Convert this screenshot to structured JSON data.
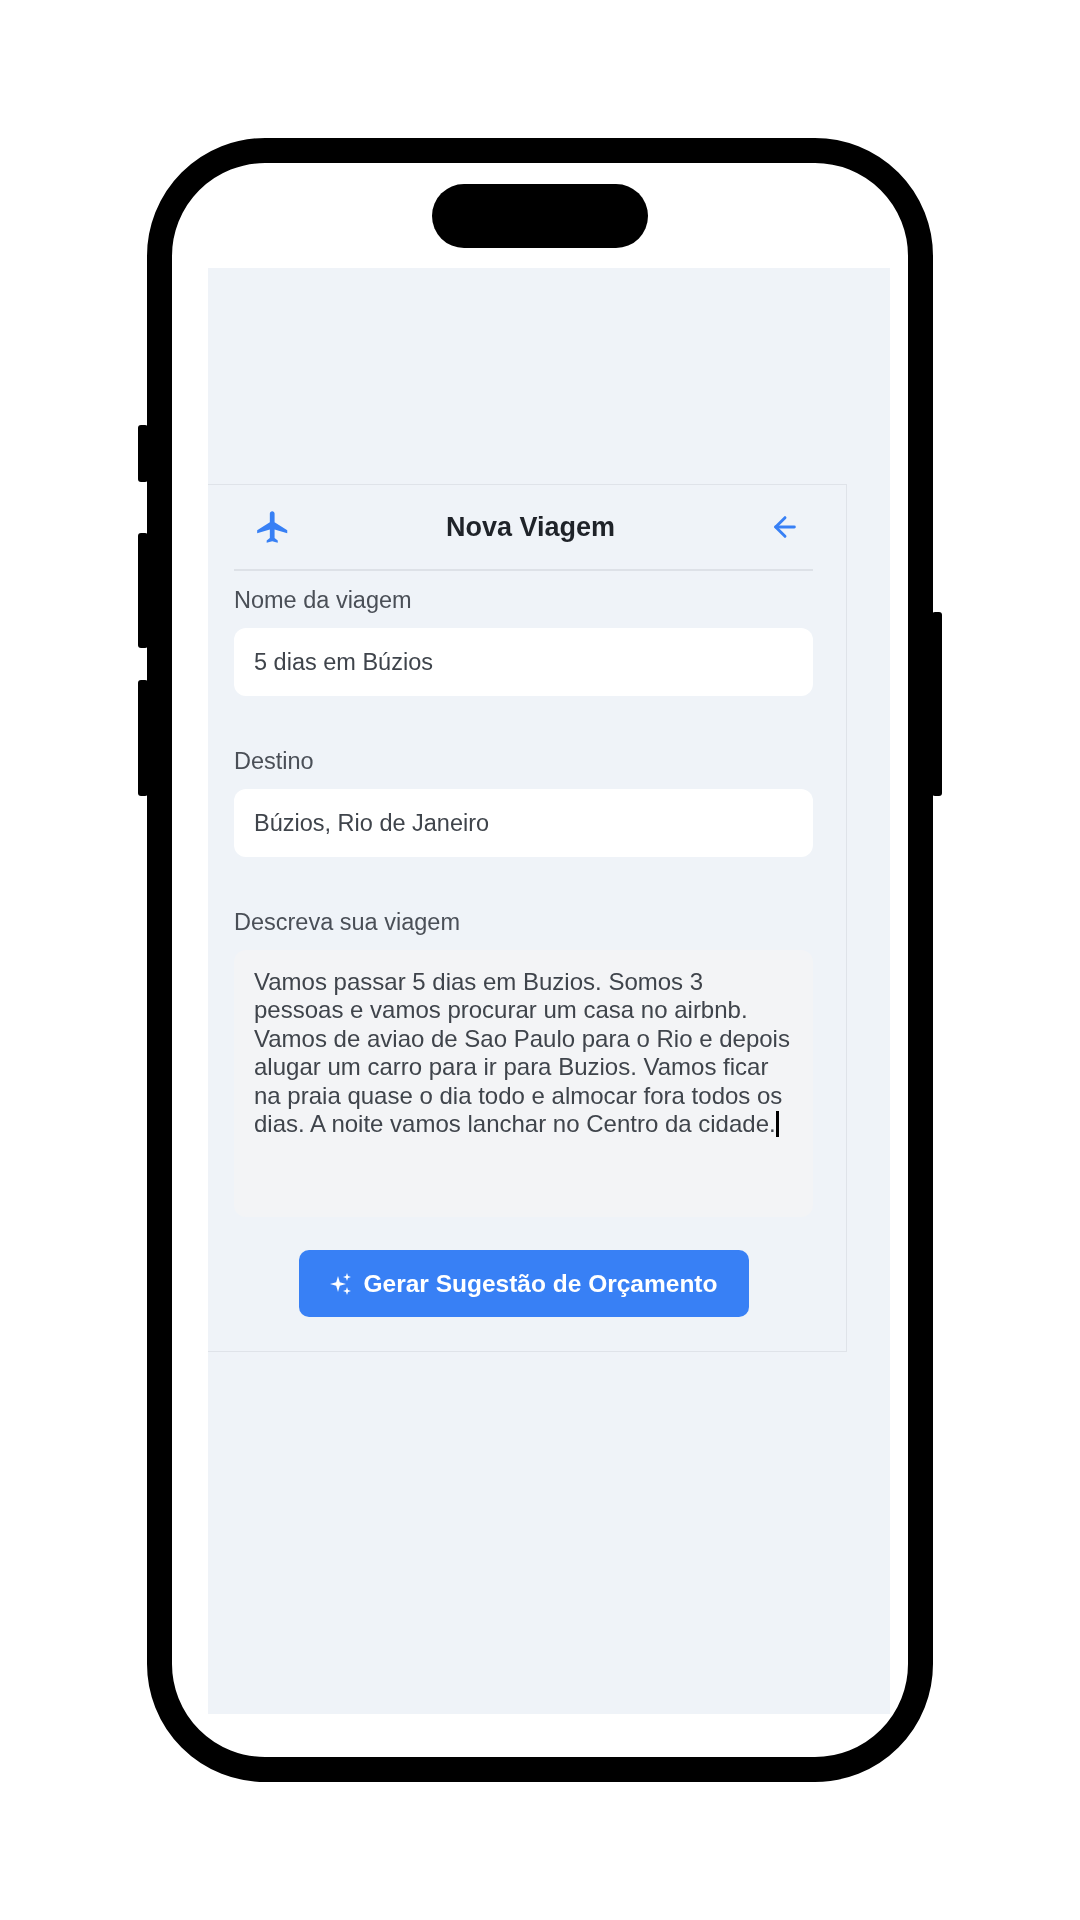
{
  "header": {
    "title": "Nova Viagem"
  },
  "fields": [
    {
      "kind": "input",
      "label": "Nome da viagem",
      "value": "5 dias em Búzios",
      "focused": false
    },
    {
      "kind": "input",
      "label": "Destino",
      "value": "Búzios, Rio de Janeiro",
      "focused": false
    },
    {
      "kind": "textarea",
      "label": "Descreva sua viagem",
      "value": "Vamos passar 5 dias em Buzios. Somos 3 pessoas e vamos procurar um casa no airbnb. Vamos de aviao de Sao Paulo para o Rio e depois alugar um carro para ir para Buzios. Vamos ficar na praia quase o dia todo e almocar fora todos os dias. A noite vamos lanchar no Centro da cidade.",
      "focused": true
    }
  ],
  "submit_button": {
    "label": "Gerar Sugestão de Orçamento"
  }
}
